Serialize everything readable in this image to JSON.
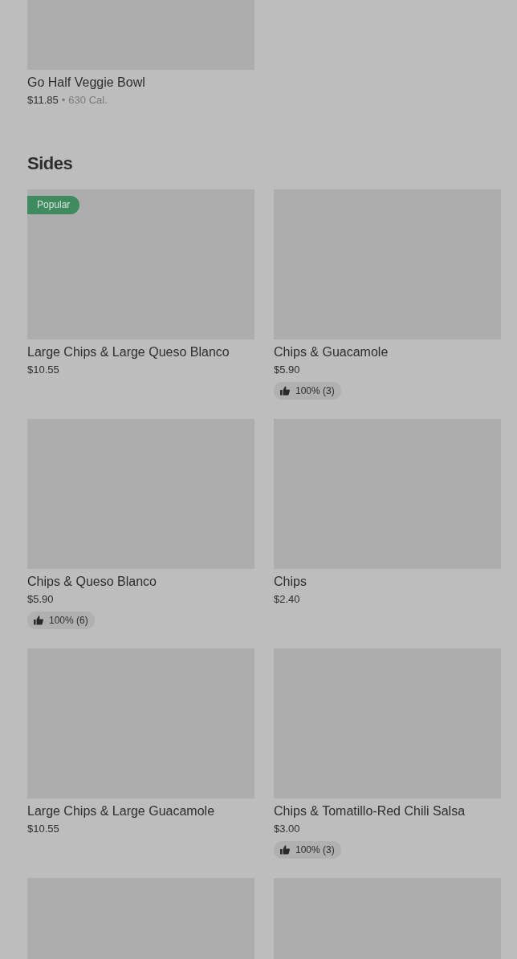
{
  "top_item": {
    "image": {
      "kind": "picture"
    },
    "name": "Go Half Veggie Bowl",
    "price": "$11.85",
    "separator": "•",
    "calories": "630 Cal."
  },
  "section": {
    "title": "Sides",
    "items": [
      {
        "image": {
          "kind": "picture"
        },
        "name": "Large Chips & Large Queso Blanco",
        "price": "$10.55",
        "badge": "Popular"
      },
      {
        "image": {
          "kind": "picture"
        },
        "name": "Chips & Guacamole",
        "price": "$5.90",
        "rating": "100% (3)"
      },
      {
        "image": {
          "kind": "picture"
        },
        "name": "Chips & Queso Blanco",
        "price": "$5.90",
        "rating": "100% (6)"
      },
      {
        "image": {
          "kind": "picture"
        },
        "name": "Chips",
        "price": "$2.40"
      },
      {
        "image": {
          "kind": "picture"
        },
        "name": "Large Chips & Large Guacamole",
        "price": "$10.55"
      },
      {
        "image": {
          "kind": "picture"
        },
        "name": "Chips & Tomatillo-Red Chili Salsa",
        "price": "$3.00",
        "rating": "100% (3)"
      },
      {
        "image": {
          "kind": "picture"
        }
      },
      {
        "image": {
          "kind": "picture"
        }
      }
    ]
  }
}
